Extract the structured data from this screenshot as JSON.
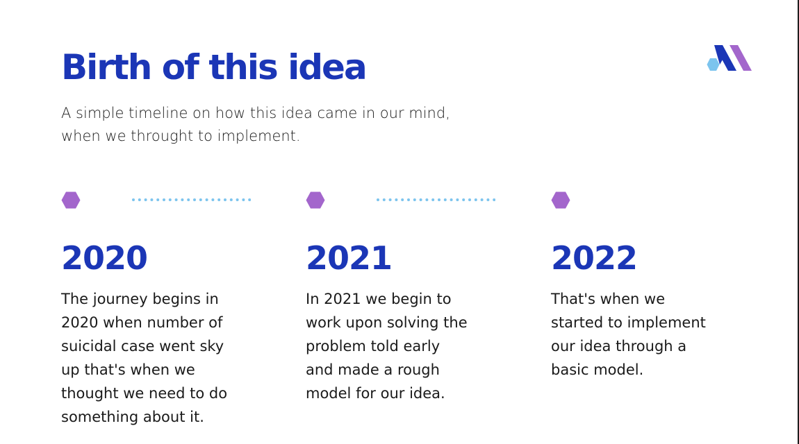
{
  "colors": {
    "heading": "#1b36b6",
    "hexagon": "#a366cc",
    "dotted_line": "#7cc4ee",
    "logo_light": "#7cc4ee",
    "logo_dark": "#1b36b6",
    "logo_purple": "#a366cc"
  },
  "slide": {
    "title": "Birth of this idea",
    "subtitle_lines": [
      "A simple timeline on how this idea came in our mind,",
      "when we throught to implement."
    ]
  },
  "logo_icon": "abstract-m-logo-icon",
  "timeline": [
    {
      "year": "2020",
      "lines": [
        "The journey begins in",
        "2020 when number of",
        "suicidal case went sky",
        "up that's when we",
        "thought we need to do",
        "something about it."
      ]
    },
    {
      "year": "2021",
      "lines": [
        "In 2021 we begin to",
        "work upon solving the",
        "problem told early",
        "and made a rough",
        "model for our idea."
      ]
    },
    {
      "year": "2022",
      "lines": [
        "That's when we",
        "started to implement",
        "our idea through a",
        "basic model."
      ]
    }
  ]
}
